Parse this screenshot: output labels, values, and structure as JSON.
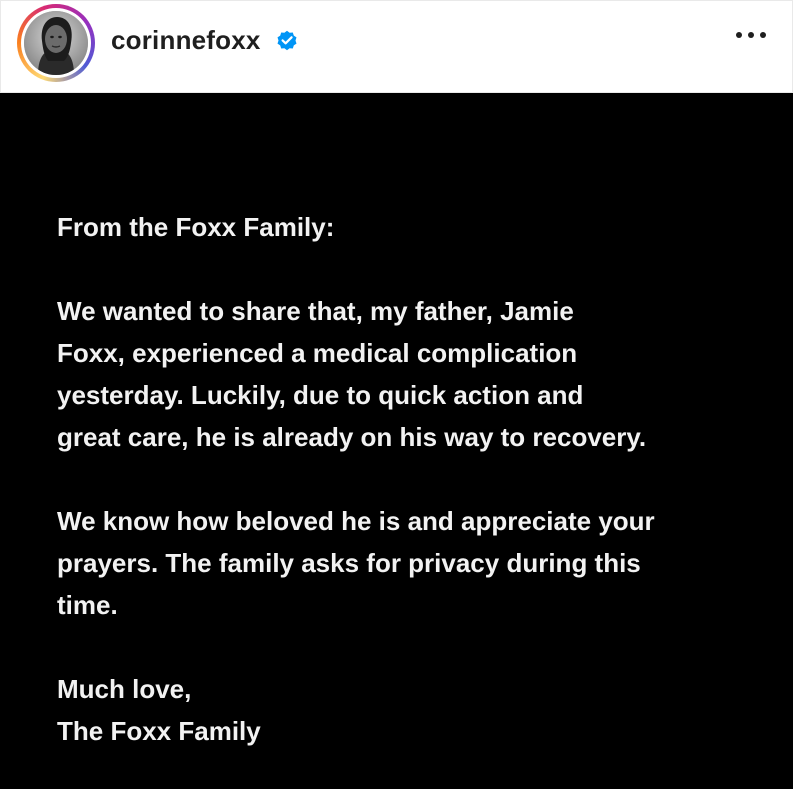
{
  "header": {
    "username": "corinnefoxx",
    "verified": true,
    "verified_color": "#0095f6",
    "avatar_ring_colors": [
      "#feda75",
      "#fa7e1e",
      "#d62976",
      "#962fbf",
      "#4f5bd5"
    ],
    "avatar_icon": "profile-photo",
    "more_icon": "more-options-icon"
  },
  "post": {
    "background": "#000000",
    "text_color": "#f2f2f2",
    "paragraphs": [
      "From the Foxx Family:",
      "We wanted to share that, my father, Jamie\nFoxx, experienced a medical complication\nyesterday. Luckily, due to quick action and\ngreat care, he is already on his way to recovery.",
      "We know how beloved he is and appreciate your\nprayers. The family asks for privacy during this\ntime.",
      "Much love,\nThe Foxx Family"
    ]
  }
}
